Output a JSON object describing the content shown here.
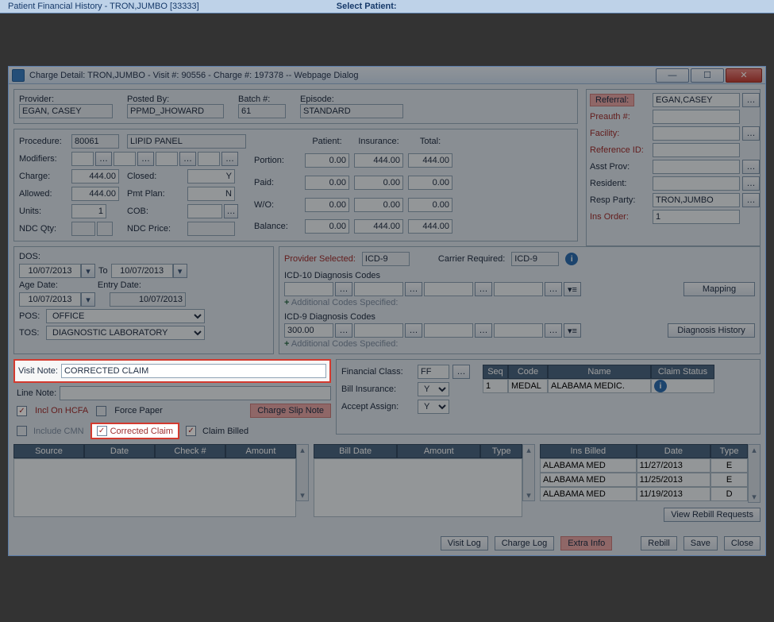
{
  "tab_behind": "Patient Financial History - TRON,JUMBO [33333]",
  "select_patient": "Select Patient:",
  "title": "Charge Detail: TRON,JUMBO - Visit #: 90556 - Charge #: 197378 -- Webpage Dialog",
  "header": {
    "provider_lbl": "Provider:",
    "provider": "EGAN, CASEY",
    "posted_lbl": "Posted By:",
    "posted": "PPMD_JHOWARD",
    "batch_lbl": "Batch #:",
    "batch": "61",
    "episode_lbl": "Episode:",
    "episode": "STANDARD"
  },
  "right": {
    "referral_lbl": "Referral:",
    "referral": "EGAN,CASEY",
    "preauth_lbl": "Preauth #:",
    "preauth": "",
    "facility_lbl": "Facility:",
    "facility": "",
    "refid_lbl": "Reference ID:",
    "refid": "",
    "asst_lbl": "Asst Prov:",
    "asst": "",
    "resident_lbl": "Resident:",
    "resident": "",
    "resp_lbl": "Resp Party:",
    "resp": "TRON,JUMBO",
    "ins_lbl": "Ins Order:",
    "ins": "1"
  },
  "proc": {
    "procedure_lbl": "Procedure:",
    "code": "80061",
    "desc": "LIPID PANEL",
    "modifiers_lbl": "Modifiers:",
    "charge_lbl": "Charge:",
    "charge": "444.00",
    "closed_lbl": "Closed:",
    "closed": "Y",
    "allowed_lbl": "Allowed:",
    "allowed": "444.00",
    "pmt_lbl": "Pmt Plan:",
    "pmt": "N",
    "units_lbl": "Units:",
    "units": "1",
    "cob_lbl": "COB:",
    "cob": "",
    "ndcq_lbl": "NDC Qty:",
    "ndcq": "",
    "ndcp_lbl": "NDC Price:",
    "ndcp": ""
  },
  "amounts": {
    "patient_lbl": "Patient:",
    "insurance_lbl": "Insurance:",
    "total_lbl": "Total:",
    "portion_lbl": "Portion:",
    "paid_lbl": "Paid:",
    "wo_lbl": "W/O:",
    "balance_lbl": "Balance:",
    "portion": [
      "0.00",
      "444.00",
      "444.00"
    ],
    "paid": [
      "0.00",
      "0.00",
      "0.00"
    ],
    "wo": [
      "0.00",
      "0.00",
      "0.00"
    ],
    "balance": [
      "0.00",
      "444.00",
      "444.00"
    ]
  },
  "dates": {
    "dos_lbl": "DOS:",
    "to": "To",
    "dos1": "10/07/2013",
    "dos2": "10/07/2013",
    "age_lbl": "Age Date:",
    "entry_lbl": "Entry Date:",
    "age": "10/07/2013",
    "entry": "10/07/2013",
    "pos_lbl": "POS:",
    "pos": "OFFICE",
    "tos_lbl": "TOS:",
    "tos": "DIAGNOSTIC LABORATORY"
  },
  "dx": {
    "prov_sel_lbl": "Provider Selected:",
    "prov_sel": "ICD-9",
    "carr_lbl": "Carrier Required:",
    "carr": "ICD-9",
    "icd10_lbl": "ICD-10 Diagnosis Codes",
    "addl": "Additional Codes Specified:",
    "icd9_lbl": "ICD-9 Diagnosis Codes",
    "icd9_1": "300.00",
    "mapping": "Mapping",
    "dxhist": "Diagnosis History"
  },
  "notes": {
    "visit_lbl": "Visit Note:",
    "visit": "CORRECTED CLAIM",
    "line_lbl": "Line Note:",
    "incl_hcfa": "Incl On HCFA",
    "force_paper": "Force Paper",
    "slip": "Charge Slip Note",
    "include_cmn": "Include CMN",
    "corrected": "Corrected Claim",
    "billed": "Claim Billed"
  },
  "fin": {
    "fc_lbl": "Financial Class:",
    "fc": "FF",
    "bill_lbl": "Bill Insurance:",
    "bill": "Y",
    "accept_lbl": "Accept Assign:",
    "accept": "Y"
  },
  "carrier_tbl": {
    "hdr": [
      "Seq",
      "Code",
      "Name",
      "Claim Status"
    ],
    "row": [
      "1",
      "MEDAL",
      "ALABAMA MEDIC.",
      ""
    ]
  },
  "pay_tbl": {
    "hdr": [
      "Source",
      "Date",
      "Check #",
      "Amount"
    ]
  },
  "bill_tbl": {
    "hdr": [
      "Bill Date",
      "Amount",
      "Type"
    ]
  },
  "ins_tbl": {
    "hdr": [
      "Ins Billed",
      "Date",
      "Type"
    ],
    "rows": [
      [
        "ALABAMA MED",
        "11/27/2013",
        "E"
      ],
      [
        "ALABAMA MED",
        "11/25/2013",
        "E"
      ],
      [
        "ALABAMA MED",
        "11/19/2013",
        "D"
      ]
    ]
  },
  "btns": {
    "view_rebill": "View Rebill Requests",
    "visit_log": "Visit Log",
    "charge_log": "Charge Log",
    "extra": "Extra Info",
    "rebill": "Rebill",
    "save": "Save",
    "close": "Close"
  }
}
